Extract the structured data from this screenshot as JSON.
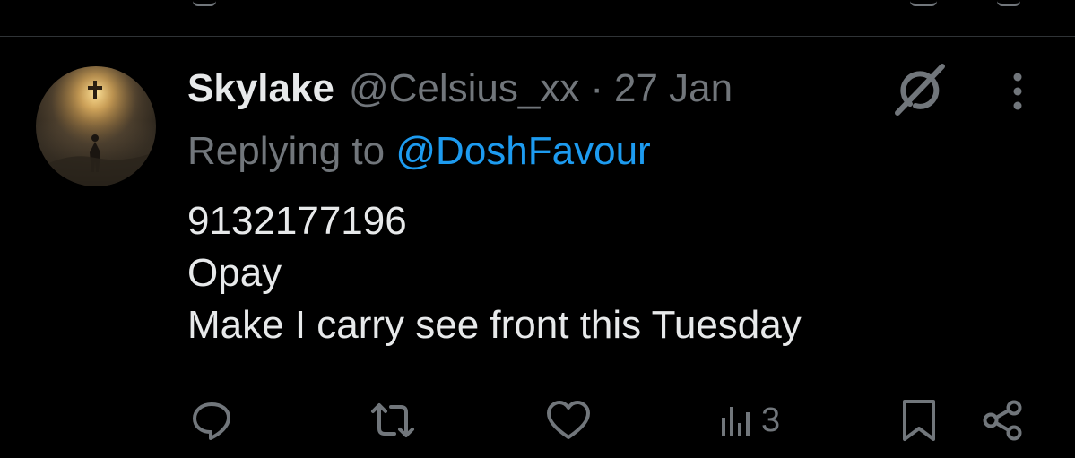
{
  "tweet": {
    "display_name": "Skylake",
    "handle": "@Celsius_xx",
    "separator": "·",
    "date": "27 Jan",
    "replying_label": "Replying to",
    "replying_to": "@DoshFavour",
    "lines": [
      "9132177196",
      "Opay",
      "Make I carry see front this Tuesday"
    ]
  },
  "actions": {
    "reply_icon": "reply-icon",
    "retweet_icon": "retweet-icon",
    "like_icon": "heart-icon",
    "views_icon": "views-icon",
    "views_count": "3",
    "bookmark_icon": "bookmark-icon",
    "share_icon": "share-icon"
  },
  "colors": {
    "background": "#000000",
    "primary_text": "#e7e9ea",
    "secondary_text": "#71767b",
    "link": "#1d9bf0",
    "divider": "#2f3336"
  }
}
